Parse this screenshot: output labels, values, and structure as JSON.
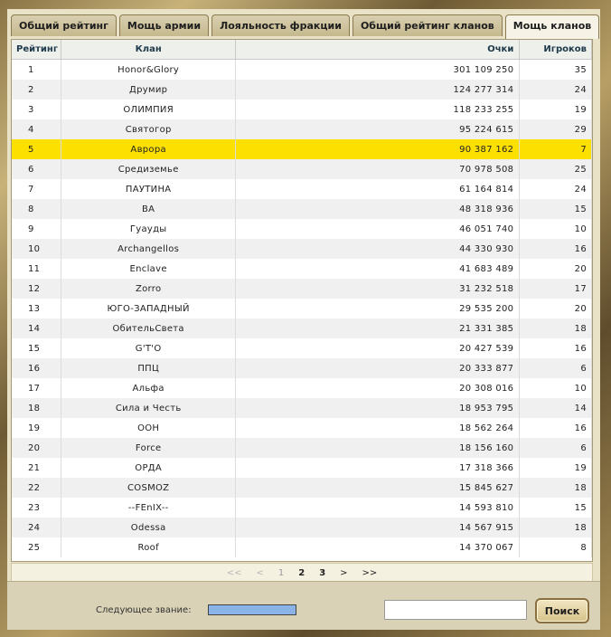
{
  "tabs": [
    {
      "label": "Общий рейтинг",
      "active": false
    },
    {
      "label": "Мощь армии",
      "active": false
    },
    {
      "label": "Лояльность фракции",
      "active": false
    },
    {
      "label": "Общий рейтинг кланов",
      "active": false
    },
    {
      "label": "Мощь кланов",
      "active": true
    }
  ],
  "table": {
    "headers": {
      "rank": "Рейтинг",
      "clan": "Клан",
      "points": "Очки",
      "players": "Игроков"
    },
    "highlight_color": "#fce100",
    "rows": [
      {
        "rank": "1",
        "clan": "Honor&Glory",
        "points": "301 109 250",
        "players": "35"
      },
      {
        "rank": "2",
        "clan": "Друмир",
        "points": "124 277 314",
        "players": "24"
      },
      {
        "rank": "3",
        "clan": "ОЛИМПИЯ",
        "points": "118 233 255",
        "players": "19"
      },
      {
        "rank": "4",
        "clan": "Святогор",
        "points": "95 224 615",
        "players": "29"
      },
      {
        "rank": "5",
        "clan": "Аврора",
        "points": "90 387 162",
        "players": "7",
        "highlight": true
      },
      {
        "rank": "6",
        "clan": "Средиземье",
        "points": "70 978 508",
        "players": "25"
      },
      {
        "rank": "7",
        "clan": "ПАУТИНА",
        "points": "61 164 814",
        "players": "24"
      },
      {
        "rank": "8",
        "clan": "ВА",
        "points": "48 318 936",
        "players": "15"
      },
      {
        "rank": "9",
        "clan": "Гуауды",
        "points": "46 051 740",
        "players": "10"
      },
      {
        "rank": "10",
        "clan": "Archangellos",
        "points": "44 330 930",
        "players": "16"
      },
      {
        "rank": "11",
        "clan": "Enclave",
        "points": "41 683 489",
        "players": "20"
      },
      {
        "rank": "12",
        "clan": "Zorro",
        "points": "31 232 518",
        "players": "17"
      },
      {
        "rank": "13",
        "clan": "ЮГО-ЗАПАДНЫЙ",
        "points": "29 535 200",
        "players": "20"
      },
      {
        "rank": "14",
        "clan": "ОбительСвета",
        "points": "21 331 385",
        "players": "18"
      },
      {
        "rank": "15",
        "clan": "G'T'O",
        "points": "20 427 539",
        "players": "16"
      },
      {
        "rank": "16",
        "clan": "ППЦ",
        "points": "20 333 877",
        "players": "6"
      },
      {
        "rank": "17",
        "clan": "Альфа",
        "points": "20 308 016",
        "players": "10"
      },
      {
        "rank": "18",
        "clan": "Сила и Честь",
        "points": "18 953 795",
        "players": "14"
      },
      {
        "rank": "19",
        "clan": "ООН",
        "points": "18 562 264",
        "players": "16"
      },
      {
        "rank": "20",
        "clan": "Force",
        "points": "18 156 160",
        "players": "6"
      },
      {
        "rank": "21",
        "clan": "ОРДА",
        "points": "17 318 366",
        "players": "19"
      },
      {
        "rank": "22",
        "clan": "COSMOZ",
        "points": "15 845 627",
        "players": "18"
      },
      {
        "rank": "23",
        "clan": "--FEnIX--",
        "points": "14 593 810",
        "players": "15"
      },
      {
        "rank": "24",
        "clan": "Odessa",
        "points": "14 567 915",
        "players": "18"
      },
      {
        "rank": "25",
        "clan": "Roof",
        "points": "14 370 067",
        "players": "8"
      }
    ]
  },
  "pagination": {
    "first": "<<",
    "prev": "<",
    "pages": [
      "1",
      "2",
      "3"
    ],
    "current": "1",
    "next": ">",
    "last": ">>"
  },
  "footer": {
    "next_rank_label": "Следующее звание:",
    "next_rank_progress": 1.0,
    "progress_color": "#8ab4e8",
    "search_value": "",
    "search_button": "Поиск"
  }
}
